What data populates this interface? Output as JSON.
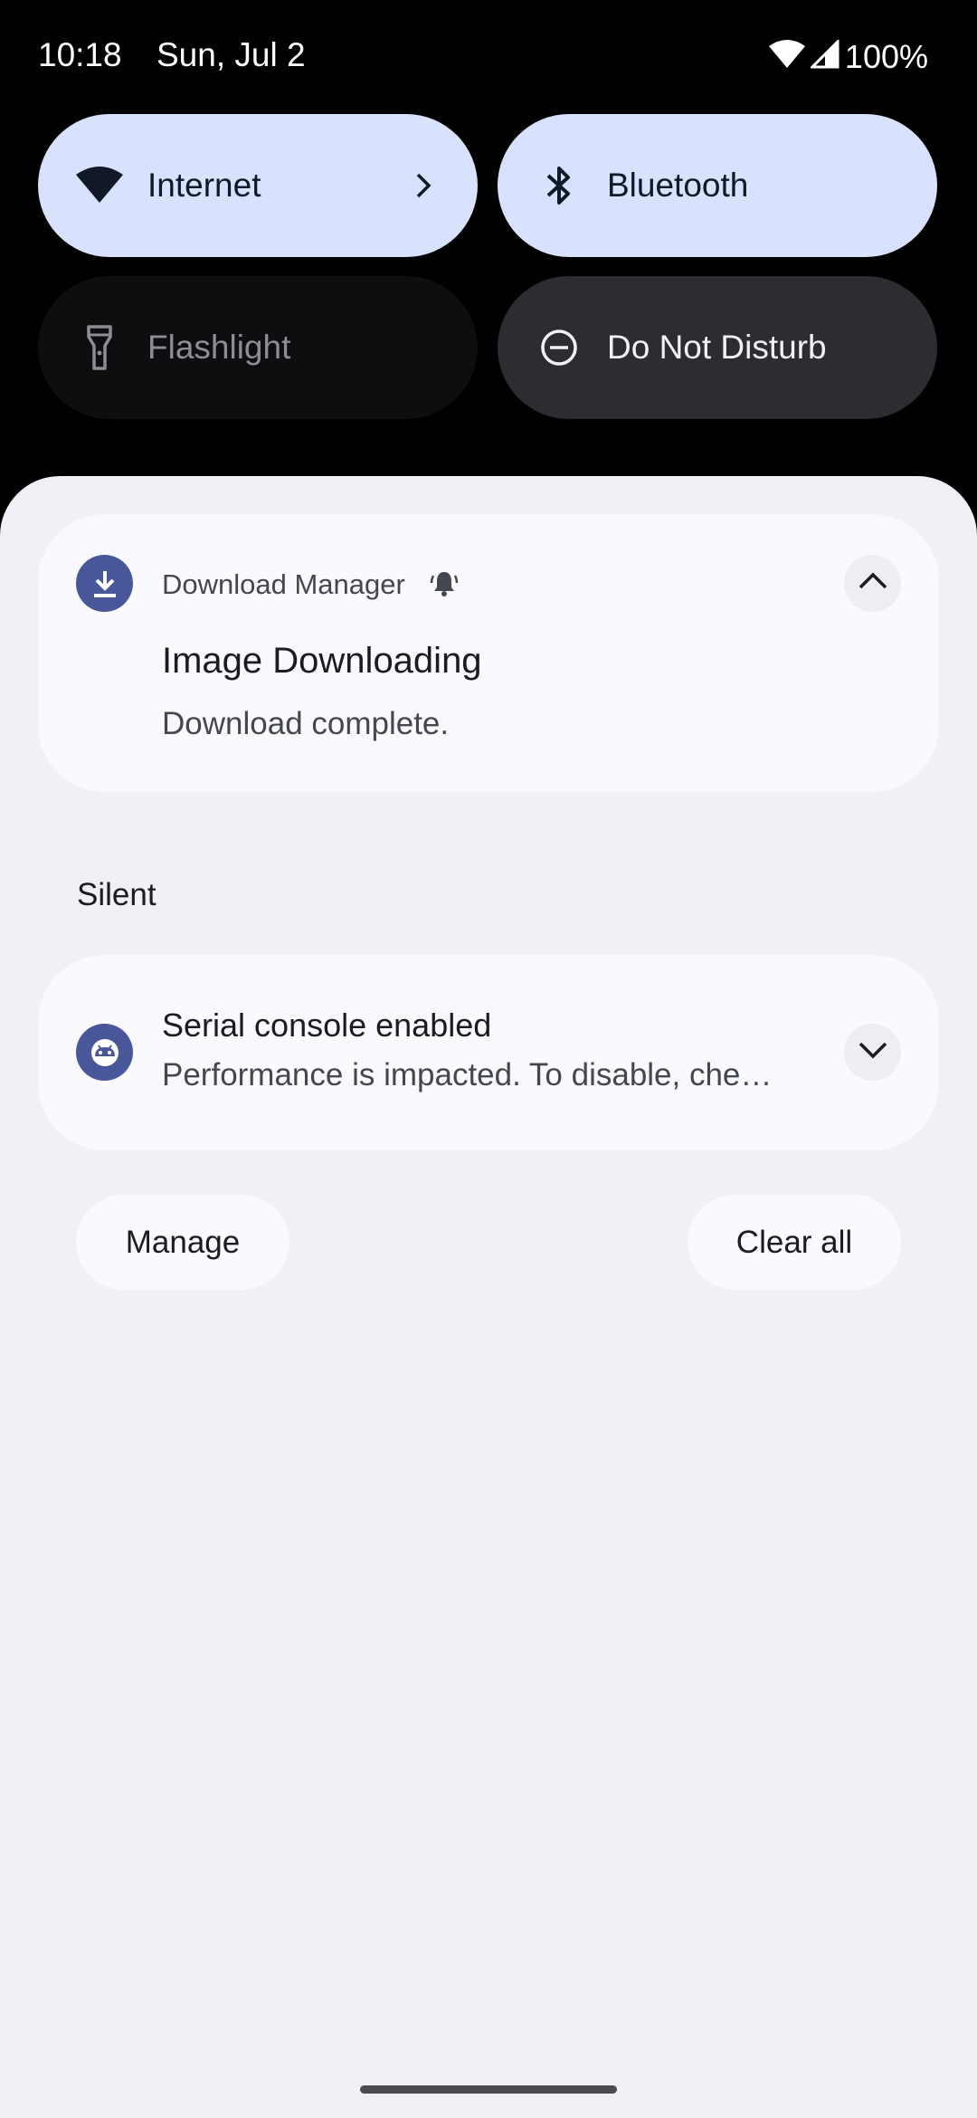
{
  "status_bar": {
    "time": "10:18",
    "date": "Sun, Jul 2",
    "battery": "100%",
    "icons": [
      "wifi-icon",
      "cell-signal-icon"
    ]
  },
  "quick_settings": {
    "tiles": [
      {
        "label": "Internet",
        "icon": "wifi-icon",
        "state": "on"
      },
      {
        "label": "Bluetooth",
        "icon": "bluetooth-icon",
        "state": "on"
      },
      {
        "label": "Flashlight",
        "icon": "flashlight-icon",
        "state": "unavailable"
      },
      {
        "label": "Do Not Disturb",
        "icon": "do-not-disturb-icon",
        "state": "off"
      }
    ]
  },
  "notifications": {
    "download": {
      "app_name": "Download Manager",
      "title": "Image Downloading",
      "text": "Download complete.",
      "icon": "download-icon"
    },
    "silent_header": "Silent",
    "serial": {
      "title": "Serial console enabled",
      "text": "Performance is impacted. To disable, che…",
      "icon": "android-icon"
    }
  },
  "actions": {
    "manage": "Manage",
    "clear_all": "Clear all"
  },
  "colors": {
    "tile_active": "#d9e2fc",
    "tile_inactive": "#2c2d31",
    "shade_bg": "#f0f0f6",
    "app_icon_bg": "#48579a"
  }
}
